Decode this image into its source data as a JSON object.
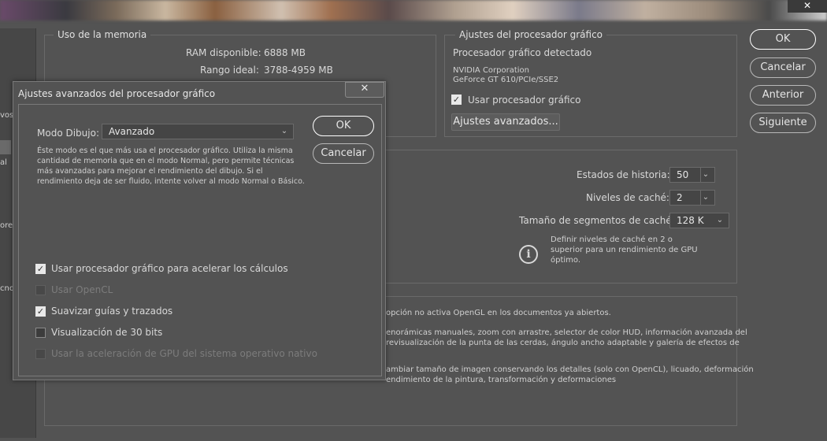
{
  "window": {
    "close_glyph": "✕"
  },
  "sidebar": {
    "items": [
      "vos",
      "al",
      "ores",
      "cnol"
    ]
  },
  "memory": {
    "title": "Uso de la memoria",
    "ram_label": "RAM disponible:",
    "ram_value": "6888 MB",
    "ideal_label": "Rango ideal:",
    "ideal_value": "3788-4959 MB"
  },
  "gpu": {
    "title": "Ajustes del procesador gráfico",
    "detected_label": "Procesador gráfico detectado",
    "vendor": "NVIDIA Corporation",
    "model": "GeForce GT 610/PCIe/SSE2",
    "use_gpu_label": "Usar procesador gráfico",
    "use_gpu_checked": true,
    "advanced_button": "Ajustes avanzados..."
  },
  "main_buttons": {
    "ok": "OK",
    "cancel": "Cancelar",
    "previous": "Anterior",
    "next": "Siguiente"
  },
  "history_cache": {
    "history_label": "Estados de historia:",
    "history_value": "50",
    "cache_levels_label": "Niveles de caché:",
    "cache_levels_value": "2",
    "tile_size_label": "Tamaño de segmentos de caché:",
    "tile_size_value": "128 K",
    "hint_line1": "Definir niveles de caché en 2 o",
    "hint_line2": "superior para un rendimiento de GPU",
    "hint_line3": "óptimo."
  },
  "bottom_text": {
    "line1": "opción no activa OpenGL en los documentos ya abiertos.",
    "line2": "enorámicas manuales, zoom con arrastre, selector de color HUD, información avanzada del",
    "line3": "revisualización de la punta de las cerdas, ángulo ancho adaptable y galería de efectos de",
    "line4": "ambiar tamaño de imagen conservando los detalles (solo con OpenCL), licuado, deformación",
    "line5": "endimiento de la pintura, transformación y deformaciones"
  },
  "dialog": {
    "title": "Ajustes avanzados del procesador gráfico",
    "close_glyph": "✕",
    "mode_label": "Modo Dibujo:",
    "mode_value": "Avanzado",
    "desc_line1": "Éste modo es el que más usa el procesador gráfico. Utiliza la misma",
    "desc_line2": "cantidad de memoria que en el modo Normal, pero permite técnicas",
    "desc_line3": "más avanzadas para mejorar el rendimiento del dibujo. Si el",
    "desc_line4": "rendimiento deja de ser fluido, intente volver al modo Normal o Básico.",
    "ok": "OK",
    "cancel": "Cancelar",
    "options": [
      {
        "label": "Usar procesador gráfico para acelerar los cálculos",
        "checked": true,
        "disabled": false
      },
      {
        "label": "Usar OpenCL",
        "checked": false,
        "disabled": true
      },
      {
        "label": "Suavizar guías y trazados",
        "checked": true,
        "disabled": false
      },
      {
        "label": "Visualización de 30 bits",
        "checked": false,
        "disabled": false
      },
      {
        "label": "Usar la aceleración de GPU del sistema operativo nativo",
        "checked": false,
        "disabled": true
      }
    ]
  }
}
